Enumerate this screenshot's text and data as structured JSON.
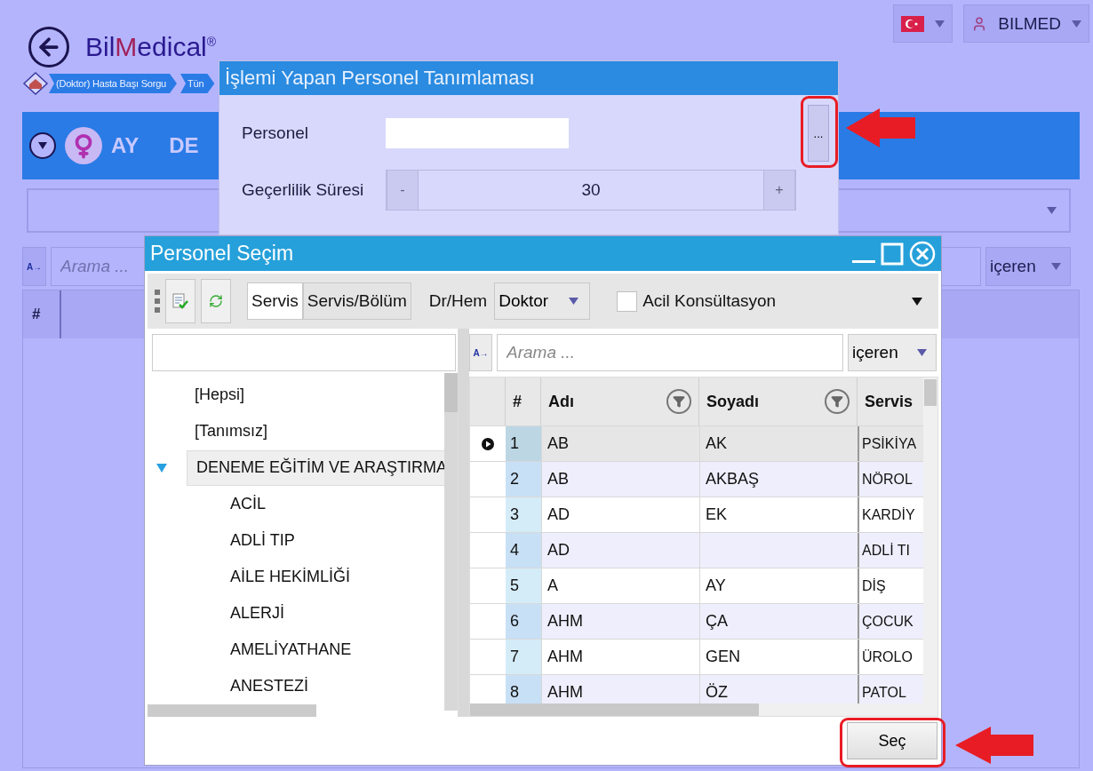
{
  "app": {
    "logo_prefix": "Bil",
    "logo_highlight": "M",
    "logo_suffix": "edical",
    "logo_mark": "®"
  },
  "header": {
    "user": "BILMED"
  },
  "breadcrumb": [
    "(Doktor) Hasta Başı Sorgu",
    "Tün"
  ],
  "patient": {
    "name_parts": [
      "AY",
      "DE"
    ]
  },
  "background_search": {
    "mode_button": "A→",
    "placeholder": "Arama ...",
    "match_mode": "içeren"
  },
  "background_grid": {
    "columns": [
      "#"
    ]
  },
  "personnel_dialog": {
    "title": "İşlemi Yapan Personel Tanımlaması",
    "personnel_label": "Personel",
    "browse_button": "...",
    "validity_label": "Geçerlilik Süresi",
    "decrement": "-",
    "validity_value": "30",
    "increment": "+"
  },
  "selection_dialog": {
    "title": "Personel Seçim",
    "view_toggles": [
      {
        "label": "Servis",
        "selected": true
      },
      {
        "label": "Servis/Bölüm",
        "selected": false
      }
    ],
    "role_label": "Dr/Hem",
    "role_value": "Doktor",
    "emergency": {
      "label": "Acil Konsültasyon",
      "checked": false
    },
    "tree": [
      {
        "label": "[Hepsi]",
        "selected": false
      },
      {
        "label": "[Tanımsız]",
        "selected": false
      },
      {
        "label": "DENEME EĞİTİM VE ARAŞTIRMA",
        "selected": true,
        "expanded": true,
        "children": [
          {
            "label": "ACİL",
            "selected": false
          },
          {
            "label": "ADLİ TIP",
            "selected": false
          },
          {
            "label": "AİLE HEKİMLİĞİ",
            "selected": false
          },
          {
            "label": "ALERJİ",
            "selected": false
          },
          {
            "label": "AMELİYATHANE",
            "selected": false
          },
          {
            "label": "ANESTEZİ",
            "selected": false
          }
        ]
      }
    ],
    "search": {
      "mode_button": "A→",
      "placeholder": "Arama ...",
      "match_mode": "içeren"
    },
    "table": {
      "columns": [
        "#",
        "Adı",
        "Soyadı",
        "Servis"
      ],
      "rows": [
        {
          "number": "1",
          "first_name": "AB",
          "last_name": "AK",
          "service": "PSİKİYA",
          "selected": true
        },
        {
          "number": "2",
          "first_name": "AB",
          "last_name": "AKBAŞ",
          "service": "NÖROL",
          "selected": false
        },
        {
          "number": "3",
          "first_name": "AD",
          "last_name": "EK",
          "service": "KARDİY",
          "selected": false
        },
        {
          "number": "4",
          "first_name": "AD",
          "service": "ADLİ TI",
          "selected": false
        },
        {
          "number": "5",
          "first_name": "A",
          "last_name": "AY",
          "service": "DİŞ",
          "selected": false
        },
        {
          "number": "6",
          "first_name": "AHM",
          "last_name": "ÇA",
          "service": "ÇOCUK",
          "selected": false
        },
        {
          "number": "7",
          "first_name": "AHM",
          "last_name": "GEN",
          "service": "ÜROLO",
          "selected": false
        },
        {
          "number": "8",
          "first_name": "AHM",
          "last_name": "ÖZ",
          "service": "PATOL",
          "selected": false
        }
      ]
    },
    "select_button": "Seç"
  }
}
